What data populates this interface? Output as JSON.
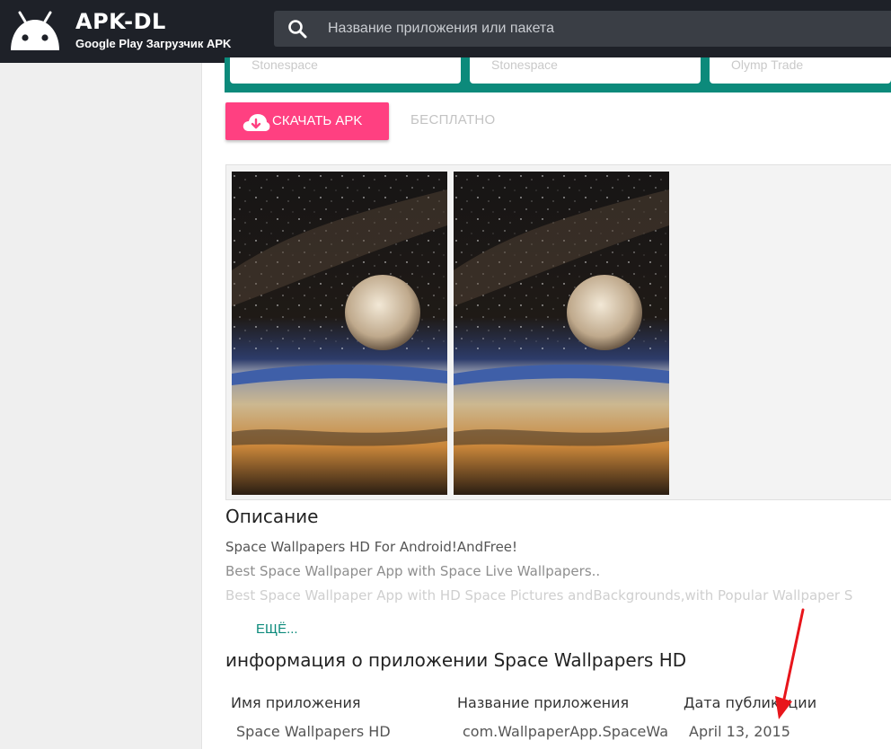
{
  "header": {
    "brand_title": "APK-DL",
    "brand_subtitle": "Google Play Загрузчик APK",
    "logo_icon": "android-icon",
    "search": {
      "placeholder": "Название приложения или пакета",
      "icon": "search-icon"
    }
  },
  "related_apps": [
    "Stonespace",
    "Stonespace",
    "Olymp Trade"
  ],
  "download": {
    "button_label": "СКАЧАТЬ APK",
    "icon": "cloud-download-icon",
    "price_label": "БЕСПЛАТНО"
  },
  "screenshots": [
    "space-wallpaper-screenshot",
    "space-wallpaper-screenshot"
  ],
  "description": {
    "title": "Описание",
    "lines": [
      "Space Wallpapers HD For Android!AndFree!",
      "Best Space Wallpaper App with Space Live Wallpapers..",
      "Best Space Wallpaper App with HD Space Pictures andBackgrounds,with Popular Wallpaper S"
    ],
    "more_label": "ЕЩЁ..."
  },
  "app_info": {
    "title": "информация о приложении Space Wallpapers HD",
    "headers": [
      "Имя приложения",
      "Название приложения",
      "Дата публикации"
    ],
    "values": [
      "Space Wallpapers HD",
      "com.WallpaperApp.SpaceWa",
      "April 13, 2015"
    ]
  },
  "colors": {
    "header_bg": "#1e2128",
    "accent_teal": "#0c8a7b",
    "download_pink": "#ff4081",
    "annotation_arrow": "#e8151b"
  }
}
